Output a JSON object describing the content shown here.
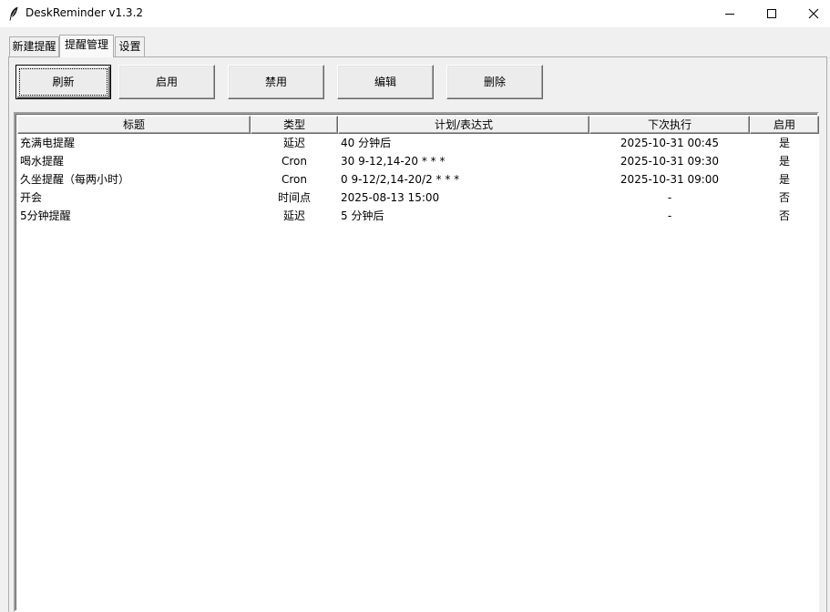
{
  "window": {
    "title": "DeskReminder v1.3.2",
    "icon": "feather-icon"
  },
  "tabs": [
    {
      "label": "新建提醒",
      "active": false
    },
    {
      "label": "提醒管理",
      "active": true
    },
    {
      "label": "设置",
      "active": false
    }
  ],
  "toolbar": {
    "refresh": "刷新",
    "enable": "启用",
    "disable": "禁用",
    "edit": "编辑",
    "delete": "删除"
  },
  "table": {
    "columns": [
      "标题",
      "类型",
      "计划/表达式",
      "下次执行",
      "启用"
    ],
    "rows": [
      [
        "充满电提醒",
        "延迟",
        "40 分钟后",
        "2025-10-31 00:45",
        "是"
      ],
      [
        "喝水提醒",
        "Cron",
        "30 9-12,14-20 * * *",
        "2025-10-31 09:30",
        "是"
      ],
      [
        "久坐提醒（每两小时）",
        "Cron",
        "0 9-12/2,14-20/2 * * *",
        "2025-10-31 09:00",
        "是"
      ],
      [
        "开会",
        "时间点",
        "2025-08-13 15:00",
        "-",
        "否"
      ],
      [
        "5分钟提醒",
        "延迟",
        "5 分钟后",
        "-",
        "否"
      ]
    ]
  }
}
